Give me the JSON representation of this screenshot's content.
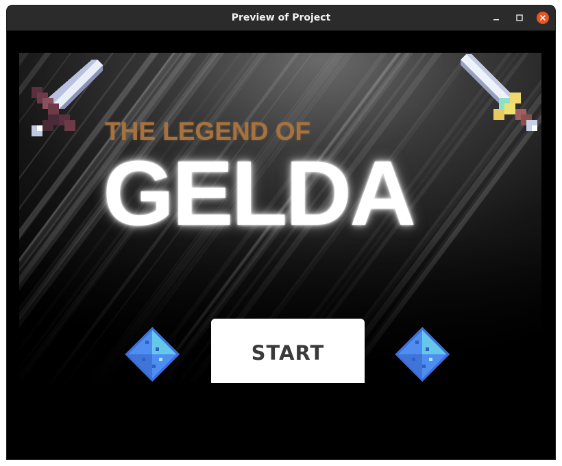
{
  "window": {
    "title": "Preview of Project",
    "controls": [
      "minimize-icon",
      "maximize-icon",
      "close-icon"
    ]
  },
  "game": {
    "subtitle": "THE LEGEND OF",
    "title": "GELDA",
    "start_label": "START",
    "icons": [
      "sword-icon",
      "sword-icon",
      "gem-icon",
      "gem-icon"
    ]
  },
  "colors": {
    "titlebar": "#2b2b2b",
    "close_button": "#e95420",
    "subtitle": "#a67340",
    "title": "#ffffff",
    "background": "#000000",
    "gem": "#4f8ef0",
    "button_bg": "#ffffff",
    "button_text": "#3a3a3a"
  }
}
